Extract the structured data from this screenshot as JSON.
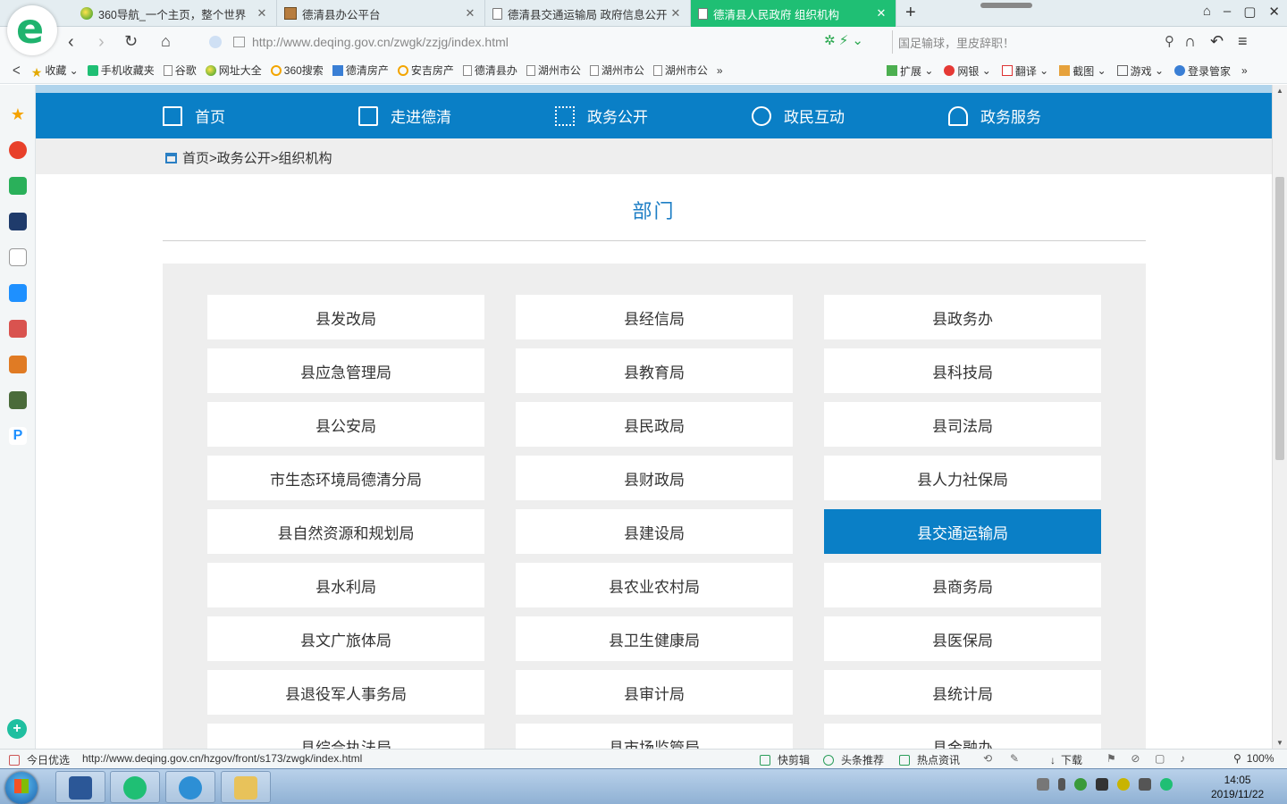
{
  "browser": {
    "tabs": [
      {
        "title": "360导航_一个主页，整个世界",
        "icon": "360-nav-icon",
        "active": false
      },
      {
        "title": "德清县办公平台",
        "icon": "image-icon",
        "active": false
      },
      {
        "title": "德清县交通运输局 政府信息公开",
        "icon": "file-icon",
        "active": false
      },
      {
        "title": "德清县人民政府 组织机构",
        "icon": "file-icon",
        "active": true
      }
    ],
    "close_glyph": "✕",
    "new_tab_glyph": "+",
    "url": "http://www.deqing.gov.cn/zwgk/zzjg/index.html",
    "search_placeholder": "国足输球，里皮辞职！",
    "window_glyphs": [
      "⌂",
      "–",
      "▢",
      "✕"
    ]
  },
  "bookmarks": {
    "left": [
      {
        "label": "收藏",
        "icon": "star-icon",
        "caret": "⌄"
      },
      {
        "label": "手机收藏夹",
        "icon": "phone-icon"
      },
      {
        "label": "谷歌",
        "icon": "file-icon"
      },
      {
        "label": "网址大全",
        "icon": "360-icon"
      },
      {
        "label": "360搜索",
        "icon": "search-ring-icon"
      },
      {
        "label": "德清房产",
        "icon": "house-icon"
      },
      {
        "label": "安吉房产",
        "icon": "search-ring-icon"
      },
      {
        "label": "德清县办",
        "icon": "file-icon"
      },
      {
        "label": "湖州市公",
        "icon": "file-icon"
      },
      {
        "label": "湖州市公",
        "icon": "file-icon"
      },
      {
        "label": "湖州市公",
        "icon": "file-icon"
      }
    ],
    "more_glyph": "»",
    "right": [
      {
        "label": "扩展",
        "icon": "extension-icon"
      },
      {
        "label": "网银",
        "icon": "bank-icon"
      },
      {
        "label": "翻译",
        "icon": "translate-icon"
      },
      {
        "label": "截图",
        "icon": "screenshot-icon"
      },
      {
        "label": "游戏",
        "icon": "game-icon"
      },
      {
        "label": "登录管家",
        "icon": "login-manager-icon"
      }
    ]
  },
  "site": {
    "nav": [
      {
        "label": "首页",
        "icon": "home-icon"
      },
      {
        "label": "走进德清",
        "icon": "book-icon"
      },
      {
        "label": "政务公开",
        "icon": "grid-icon"
      },
      {
        "label": "政民互动",
        "icon": "chat-icon"
      },
      {
        "label": "政务服务",
        "icon": "user-icon"
      }
    ],
    "breadcrumb": "首页>政务公开>组织机构",
    "section_title": "部门",
    "departments": [
      "县发改局",
      "县经信局",
      "县政务办",
      "县应急管理局",
      "县教育局",
      "县科技局",
      "县公安局",
      "县民政局",
      "县司法局",
      "市生态环境局德清分局",
      "县财政局",
      "县人力社保局",
      "县自然资源和规划局",
      "县建设局",
      "县交通运输局",
      "县水利局",
      "县农业农村局",
      "县商务局",
      "县文广旅体局",
      "县卫生健康局",
      "县医保局",
      "县退役军人事务局",
      "县审计局",
      "县统计局",
      "县综合执法局",
      "县市场监管局",
      "县金融办"
    ],
    "selected_department": "县交通运输局",
    "colors": {
      "primary": "#0a7fc6",
      "panel": "#eeeeee",
      "tab_active": "#1fbf74"
    }
  },
  "status": {
    "left_label": "今日优选",
    "hover_url": "http://www.deqing.gov.cn/hzgov/front/s173/zwgk/index.html",
    "items": [
      "快剪辑",
      "头条推荐",
      "热点资讯",
      "下载"
    ],
    "zoom": "100%"
  },
  "taskbar": {
    "time": "14:05",
    "date": "2019/11/22"
  }
}
